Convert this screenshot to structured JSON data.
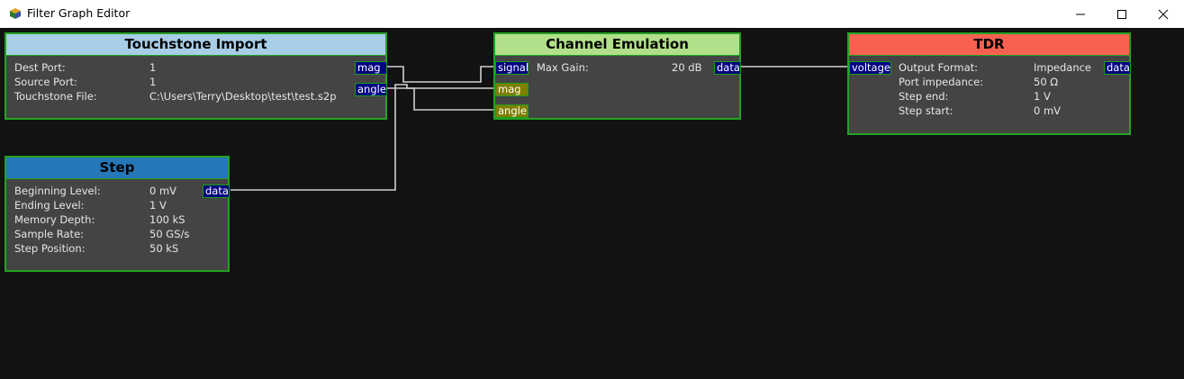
{
  "window": {
    "title": "Filter Graph Editor"
  },
  "nodes": {
    "touchstone": {
      "title": "Touchstone Import",
      "header_color": "#a7cde7",
      "props": [
        {
          "label": "Dest Port:",
          "value": "1"
        },
        {
          "label": "Source Port:",
          "value": "1"
        },
        {
          "label": "Touchstone File:",
          "value": "C:\\Users\\Terry\\Desktop\\test\\test.s2p"
        }
      ],
      "outputs": [
        "mag",
        "angle"
      ]
    },
    "channel": {
      "title": "Channel Emulation",
      "header_color": "#b2e08a",
      "props": [
        {
          "label": "Max Gain:",
          "value": "20 dB"
        }
      ],
      "inputs": [
        "signal",
        "mag",
        "angle"
      ],
      "outputs": [
        "data"
      ]
    },
    "tdr": {
      "title": "TDR",
      "header_color": "#f86050",
      "props": [
        {
          "label": "Output Format:",
          "value": "Impedance"
        },
        {
          "label": "Port impedance:",
          "value": "50 Ω"
        },
        {
          "label": "Step end:",
          "value": "1 V"
        },
        {
          "label": "Step start:",
          "value": "0 mV"
        }
      ],
      "inputs": [
        "voltage"
      ],
      "outputs": [
        "data"
      ]
    },
    "step": {
      "title": "Step",
      "header_color": "#2677b8",
      "props": [
        {
          "label": "Beginning Level:",
          "value": "0 mV"
        },
        {
          "label": "Ending Level:",
          "value": "1 V"
        },
        {
          "label": "Memory Depth:",
          "value": "100 kS"
        },
        {
          "label": "Sample Rate:",
          "value": "50 GS/s"
        },
        {
          "label": "Step Position:",
          "value": "50 kS"
        }
      ],
      "outputs": [
        "data"
      ]
    }
  },
  "colors": {
    "canvas": "#121212",
    "node_body": "#444444",
    "node_border": "#22a322",
    "port_blue": "#000080",
    "port_olive": "#7f7f00",
    "wire": "#d0d0d0"
  }
}
